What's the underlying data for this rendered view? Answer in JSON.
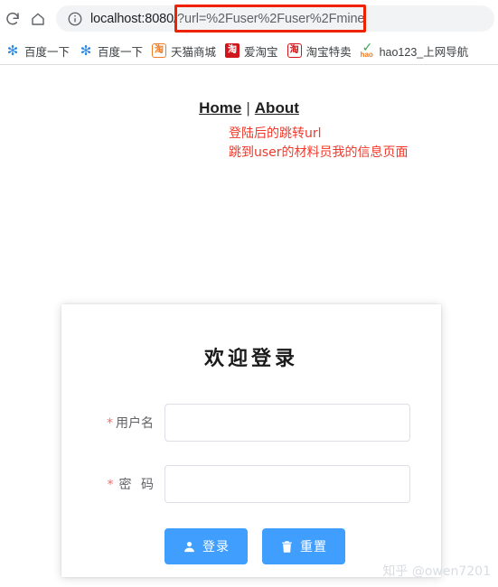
{
  "browser": {
    "toolbar": {
      "reload_icon": "reload-icon",
      "home_icon": "home-icon"
    },
    "omnibox": {
      "info_icon": "info-circle-icon",
      "url_host": "localhost:8080/",
      "url_query": "?url=%2Fuser%2Fuser%2Fmine",
      "url_full": "localhost:8080/?url=%2Fuser%2Fuser%2Fmine",
      "highlight_color": "#ee2200"
    },
    "bookmarks": [
      {
        "label": "百度一下",
        "icon": "baidu-paw-icon",
        "glyph": "✻",
        "style": "ico-baidu"
      },
      {
        "label": "百度一下",
        "icon": "baidu-paw-icon",
        "glyph": "✻",
        "style": "ico-baidu"
      },
      {
        "label": "天猫商城",
        "icon": "tmall-icon",
        "glyph": "淘",
        "style": "ico-tmall"
      },
      {
        "label": "爱淘宝",
        "icon": "taobao-icon",
        "glyph": "淘",
        "style": "ico-aitao"
      },
      {
        "label": "淘宝特卖",
        "icon": "taobao-sale-icon",
        "glyph": "淘",
        "style": "ico-tetai"
      },
      {
        "label": "hao123_上网导航",
        "icon": "hao123-icon",
        "glyph": "hao",
        "style": "ico-hao"
      }
    ]
  },
  "page": {
    "nav": {
      "home": "Home",
      "separator": "|",
      "about": "About"
    },
    "annotation": {
      "line1": "登陆后的跳转url",
      "line2": "跳到user的材料员我的信息页面",
      "color": "#f0392b",
      "arrow_icon": "up-arrow-annotation-icon"
    },
    "login_card": {
      "title": "欢迎登录",
      "fields": [
        {
          "required_mark": "*",
          "label": "用户名",
          "value": "",
          "placeholder": ""
        },
        {
          "required_mark": "*",
          "label": "密 码",
          "value": "",
          "placeholder": ""
        }
      ],
      "buttons": [
        {
          "label": "登录",
          "icon": "user-icon",
          "color": "#409eff"
        },
        {
          "label": "重置",
          "icon": "trash-icon",
          "color": "#409eff"
        }
      ]
    },
    "watermark": "知乎 @owen7201"
  }
}
